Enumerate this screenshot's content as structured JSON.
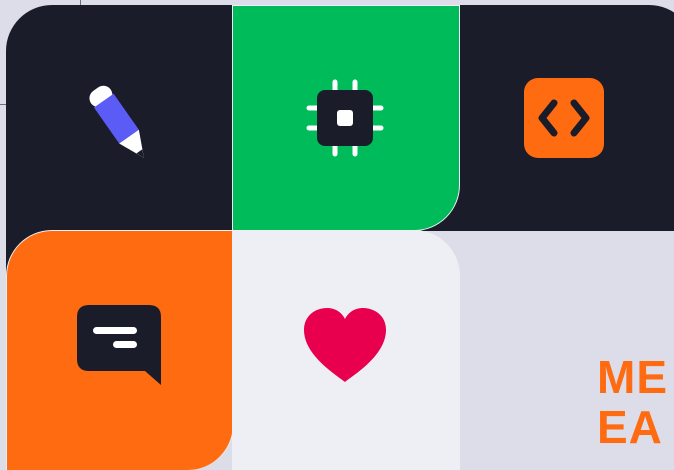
{
  "tiles": [
    {
      "name": "pencil",
      "color": "#1a1c2a",
      "icon": "pencil-icon",
      "icon_colors": [
        "#ffffff",
        "#5b5bf6"
      ]
    },
    {
      "name": "chip",
      "color": "#00bb5a",
      "icon": "chip-icon",
      "icon_colors": [
        "#1a1c2a",
        "#ffffff"
      ]
    },
    {
      "name": "code",
      "color": "#1a1c2a",
      "icon": "code-brackets-icon",
      "icon_colors": [
        "#ff6b10",
        "#1a1c2a"
      ]
    },
    {
      "name": "chat",
      "color": "#ff6b10",
      "icon": "chat-bubble-icon",
      "icon_colors": [
        "#1a1c2a",
        "#ffffff"
      ]
    },
    {
      "name": "heart",
      "color": "#eeeff5",
      "icon": "heart-icon",
      "icon_colors": [
        "#e8004f"
      ]
    }
  ],
  "background": "#dcdde8",
  "headline": {
    "line1": "ME",
    "line2": "EA",
    "color": "#ff6b10"
  }
}
